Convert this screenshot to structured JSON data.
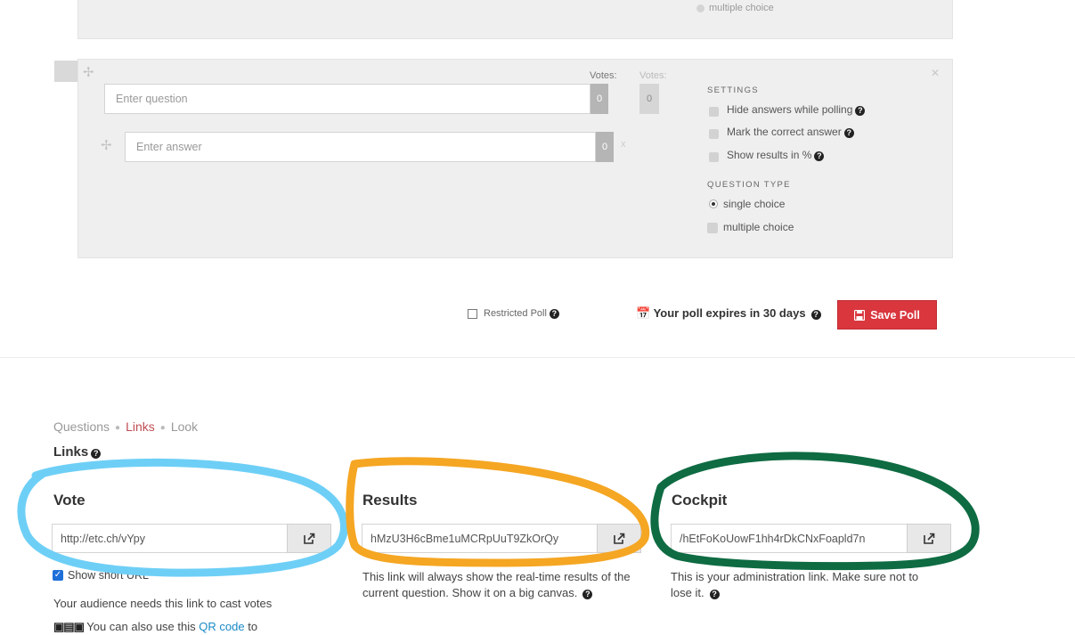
{
  "top_panel": {
    "cut_label": "multiple choice"
  },
  "question_panel": {
    "votes_label": "Votes:",
    "votes_label_2": "Votes:",
    "question_placeholder": "Enter question",
    "question_votes": "0",
    "question_votes_2": "0",
    "answer_placeholder": "Enter answer",
    "answer_votes": "0",
    "answer_x": "x",
    "settings": {
      "heading": "SETTINGS",
      "options": [
        "Hide answers while polling",
        "Mark the correct answer",
        "Show results in %"
      ]
    },
    "question_type": {
      "heading": "QUESTION TYPE",
      "options": [
        "single choice",
        "multiple choice"
      ],
      "selected": "single choice"
    }
  },
  "footer": {
    "restricted_label": "Restricted Poll",
    "expires_label": "Your poll expires in 30 days",
    "save_label": "Save Poll"
  },
  "nav": {
    "items": [
      "Questions",
      "Links",
      "Look"
    ],
    "active": "Links"
  },
  "links": {
    "title": "Links",
    "vote": {
      "title": "Vote",
      "url": "http://etc.ch/vYpy",
      "show_short_label": "Show short URL",
      "desc": "Your audience needs this link to cast votes",
      "qr_pre": "You can also use this",
      "qr_link": "QR code",
      "qr_post": "to"
    },
    "results": {
      "title": "Results",
      "url": "hMzU3H6cBme1uMCRpUuT9ZkOrQy",
      "desc": "This link will always show the real-time results of the current question. Show it on a big canvas."
    },
    "cockpit": {
      "title": "Cockpit",
      "url": "/hEtFoKoUowF1hh4rDkCNxFoapld7n",
      "desc": "This is your administration link. Make sure not to lose it."
    }
  },
  "colors": {
    "save_red": "#d9363e",
    "active_nav": "#c04e54",
    "vote_circle": "#6ecff6",
    "results_circle": "#f5a623",
    "cockpit_circle": "#0e6b42"
  }
}
